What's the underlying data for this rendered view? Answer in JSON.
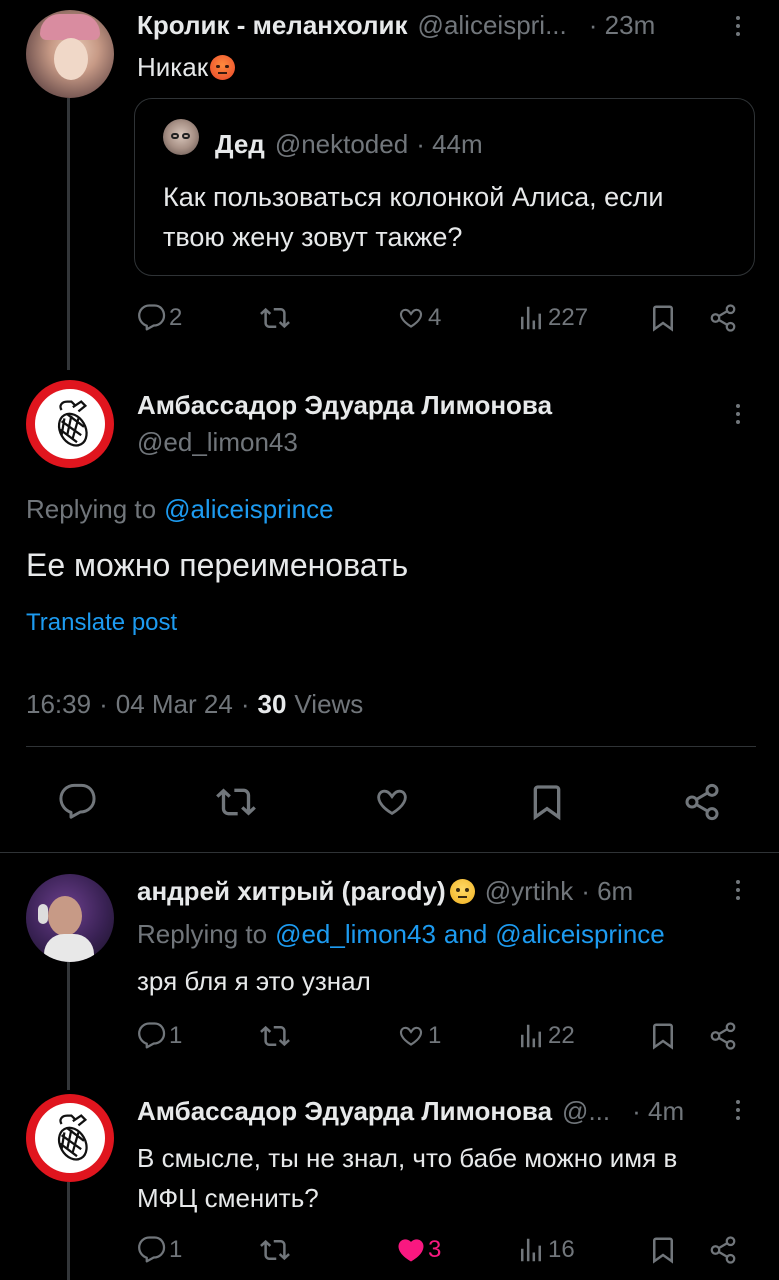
{
  "post1": {
    "author_name": "Кролик - меланхолик",
    "author_handle": "@aliceispri...",
    "time": "· 23m",
    "text": "Никак",
    "quote": {
      "author_name": "Дед",
      "author_handle": "@nektoded",
      "time": "· 44m",
      "text_line1": "Как пользоваться колонкой Алиса, если",
      "text_line2": "твою жену зовут также?"
    },
    "replies": "2",
    "reposts": "",
    "likes": "4",
    "views": "227"
  },
  "main_post": {
    "author_name": "Амбассадор Эдуарда Лимонова",
    "author_handle": "@ed_limon43",
    "replying_prefix": "Replying to",
    "replying_handle": "@aliceisprince",
    "text": "Ее можно переименовать",
    "translate": "Translate post",
    "time": "16:39",
    "date": "04 Mar 24",
    "views_count": "30",
    "views_label": "Views"
  },
  "reply1": {
    "author_name": "андрей хитрый (parody)",
    "author_handle": "@yrtihk",
    "time": "· 6m",
    "replying_prefix": "Replying to",
    "replying_handle1": "@ed_limon43",
    "replying_and": "and",
    "replying_handle2": "@aliceisprince",
    "text": "зря бля я это узнал",
    "replies": "1",
    "likes": "1",
    "views": "22"
  },
  "reply2": {
    "author_name": "Амбассадор Эдуарда Лимонова",
    "author_handle": "@...",
    "time": "· 4m",
    "text_line1": "В смысле, ты не знал, что бабе можно имя в",
    "text_line2": "МФЦ сменить?",
    "replies": "1",
    "likes": "3",
    "views": "16"
  },
  "colors": {
    "background": "#000000",
    "text": "#e7e9ea",
    "muted": "#71767b",
    "link": "#1d9bf0",
    "liked": "#f91880",
    "divider": "#2f3336"
  }
}
